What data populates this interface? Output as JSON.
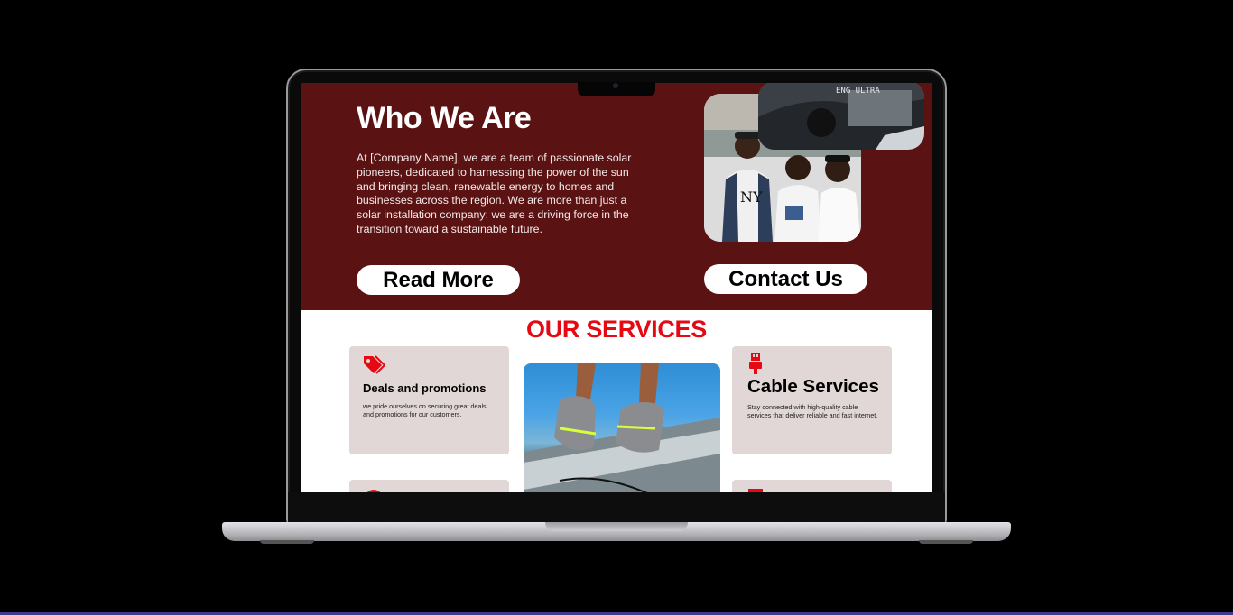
{
  "colors": {
    "page_background": "#000000",
    "hero_background": "#5b1212",
    "accent_red": "#e50914",
    "card_background": "#e1d7d7"
  },
  "hero": {
    "title": "Who We Are",
    "body": "At [Company Name], we are a team of passionate solar pioneers, dedicated to harnessing the power of the sun and bringing clean, renewable energy to homes and businesses across the region. We are more than just a solar installation company; we are a driving force in the transition toward a sustainable future.",
    "read_more_label": "Read More",
    "contact_label": "Contact Us",
    "photo_night_text": "ENG  ULTRA"
  },
  "services": {
    "title": "OUR SERVICES",
    "cards": [
      {
        "icon": "price-tags-icon",
        "title": "Deals and promotions",
        "body": "we pride ourselves on securing great deals and promotions for our customers."
      },
      {
        "icon": "usb-plug-icon",
        "title": "Cable Services",
        "body": "Stay connected with high-quality cable services that deliver reliable and fast internet."
      }
    ],
    "lower_card_icons": [
      "circle-icon",
      "tool-icon"
    ]
  }
}
